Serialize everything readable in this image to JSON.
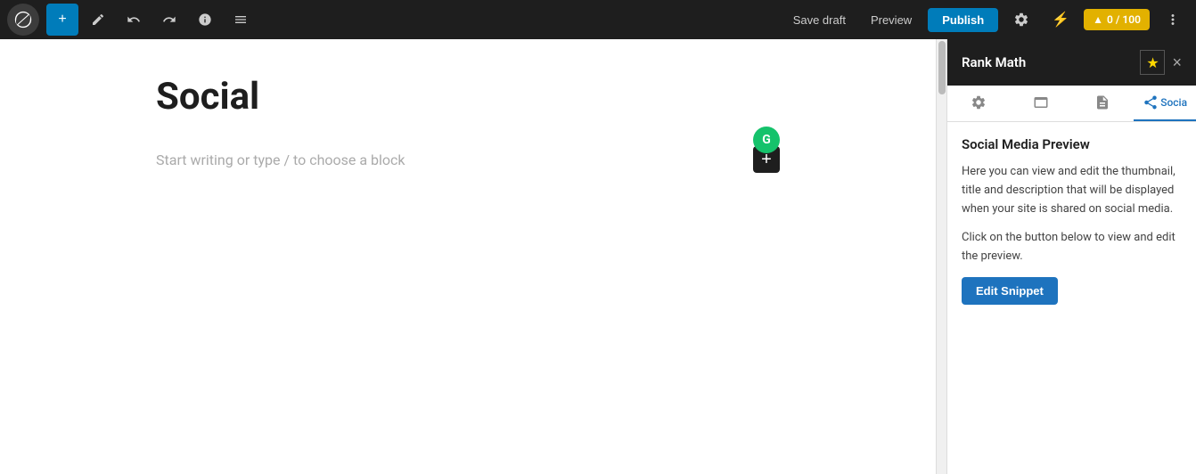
{
  "toolbar": {
    "wp_logo_alt": "WordPress",
    "add_label": "+",
    "edit_label": "✏",
    "undo_label": "↩",
    "redo_label": "↪",
    "info_label": "ℹ",
    "list_label": "≡",
    "save_draft_label": "Save draft",
    "preview_label": "Preview",
    "publish_label": "Publish",
    "settings_label": "⚙",
    "rank_math_icon": "🔥",
    "score_label": "0 / 100",
    "more_label": "⋮"
  },
  "editor": {
    "post_title": "Social",
    "block_placeholder": "Start writing or type / to choose a block",
    "grammarly_letter": "G"
  },
  "rank_math_panel": {
    "title": "Rank Math",
    "star_icon": "★",
    "close_icon": "×",
    "tabs": [
      {
        "id": "settings",
        "icon": "⚙",
        "label": "Settings"
      },
      {
        "id": "snippet",
        "icon": "🗂",
        "label": "Snippet"
      },
      {
        "id": "schema",
        "icon": "📄",
        "label": "Schema"
      },
      {
        "id": "social",
        "icon": "🔗",
        "label": "Social",
        "active": true
      }
    ],
    "social_tab": {
      "section_title": "Social Media Preview",
      "description_1": "Here you can view and edit the thumbnail, title and description that will be displayed when your site is shared on social media.",
      "description_2": "Click on the button below to view and edit the preview.",
      "edit_snippet_label": "Edit Snippet"
    }
  },
  "colors": {
    "publish_bg": "#007cba",
    "score_bg": "#e2b100",
    "edit_snippet_bg": "#1e73be",
    "panel_header_bg": "#1e1e1e",
    "toolbar_bg": "#1e1e1e",
    "grammarly_bg": "#15c26b"
  }
}
